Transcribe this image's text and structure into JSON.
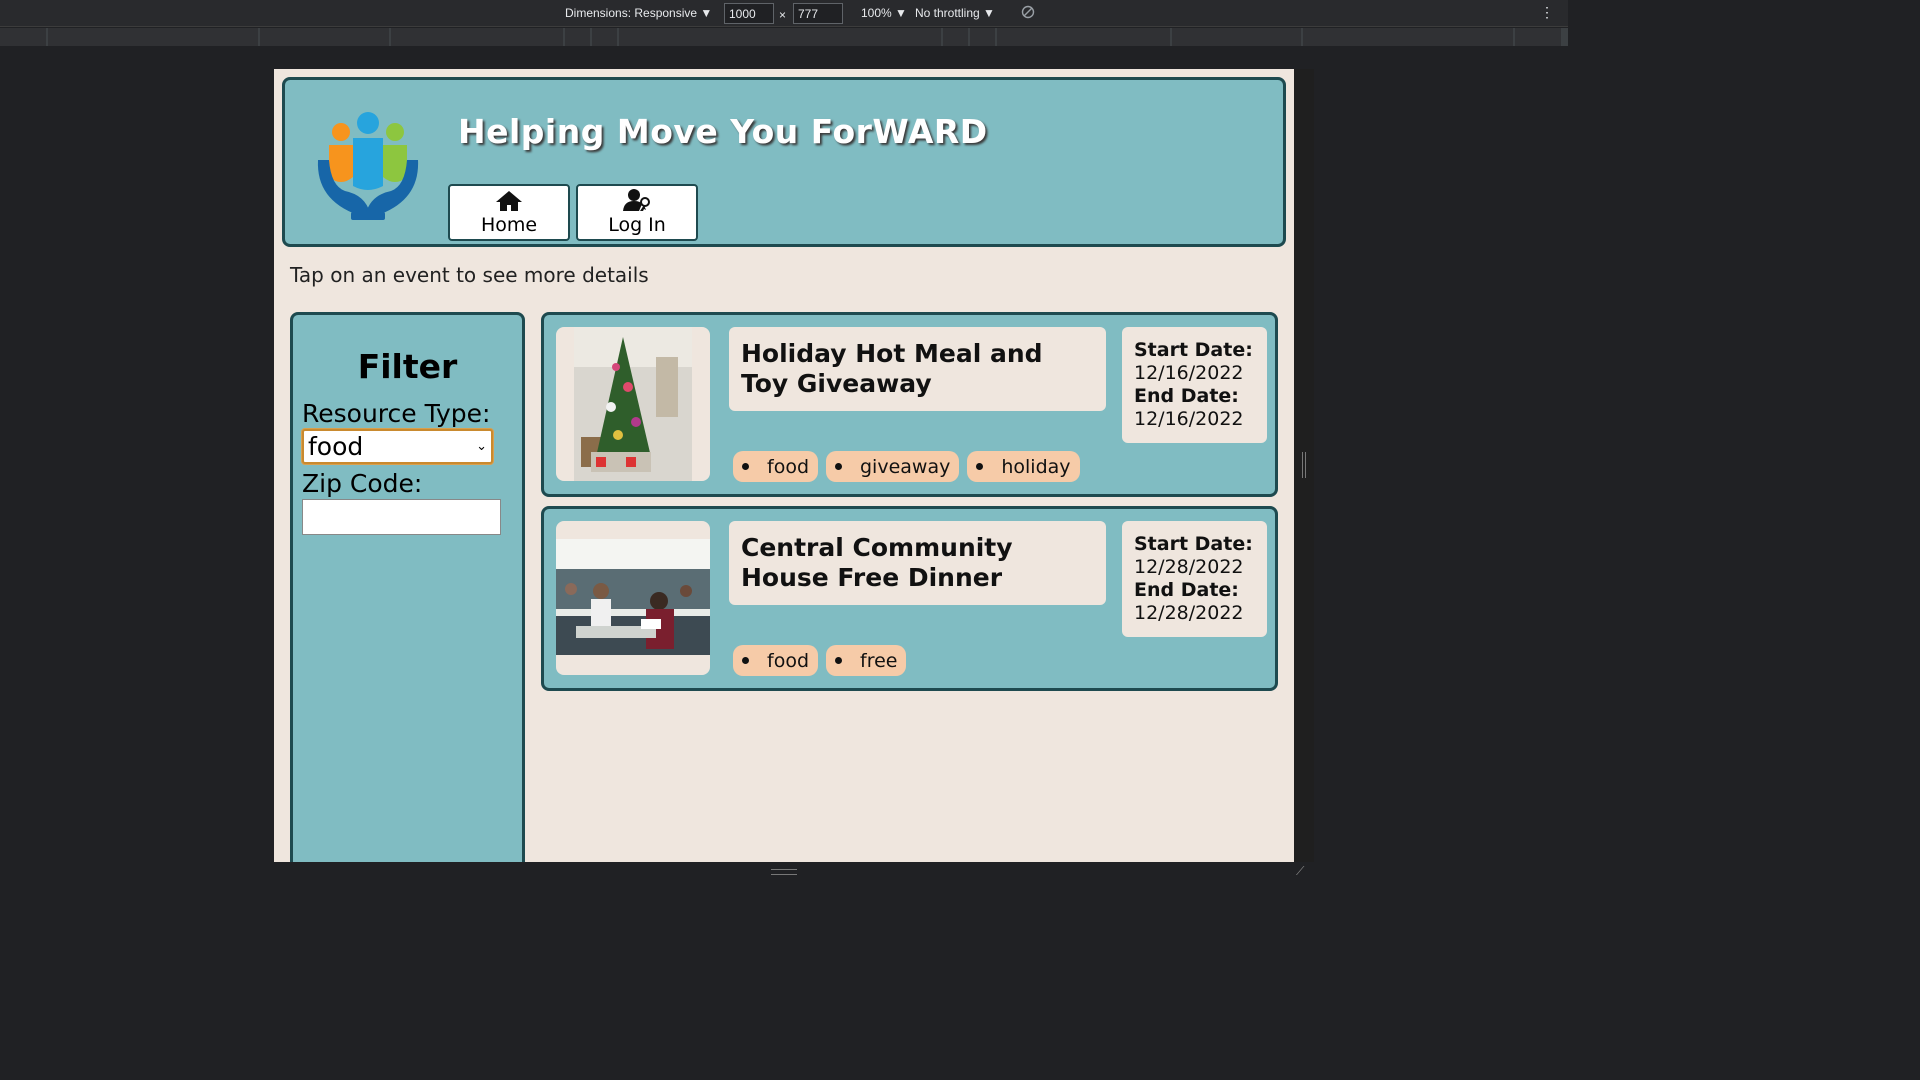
{
  "devtools": {
    "dimensions_label": "Dimensions: Responsive ▼",
    "width_value": "1000",
    "times": "×",
    "height_value": "777",
    "zoom": "100% ▼",
    "throttling": "No throttling ▼",
    "rotate_icon": "rotate-icon",
    "menu_icon": "⋮"
  },
  "header": {
    "title": "Helping Move You ForWARD",
    "logo_icon": "people-in-hands-logo",
    "nav": [
      {
        "label": "Home",
        "icon": "home-icon"
      },
      {
        "label": "Log In",
        "icon": "user-key-icon"
      }
    ]
  },
  "instructions": "Tap on an event to see more details",
  "filter": {
    "title": "Filter",
    "resource_type_label": "Resource Type:",
    "resource_type_value": "food",
    "zip_label": "Zip Code:",
    "zip_value": ""
  },
  "events": [
    {
      "title": "Holiday Hot Meal and Toy Giveaway",
      "start_label": "Start Date:",
      "start_date": "12/16/2022",
      "end_label": "End Date:",
      "end_date": "12/16/2022",
      "tags": [
        "food",
        "giveaway",
        "holiday"
      ]
    },
    {
      "title": "Central Community House Free Dinner",
      "start_label": "Start Date:",
      "start_date": "12/28/2022",
      "end_label": "End Date:",
      "end_date": "12/28/2022",
      "tags": [
        "food",
        "free"
      ]
    }
  ],
  "colors": {
    "panel": "#80bcc2",
    "border": "#1e4a4f",
    "page_bg": "#efe6de",
    "tag_bg": "#f6cba8"
  }
}
